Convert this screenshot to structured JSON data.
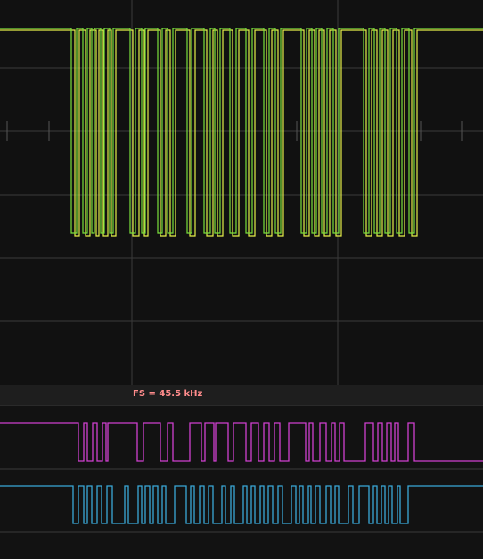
{
  "status": {
    "sample_rate_label": "FS = 45.5 kHz"
  },
  "colors": {
    "background": "#121212",
    "grid": "#3a3a3a",
    "analog_trace_yellow": "#e6f04a",
    "analog_trace_green": "#7ae03c",
    "digital_trace_magenta": "#d040d0",
    "digital_trace_cyan": "#3aa8d8",
    "fs_label": "#ff8c8c"
  },
  "traces": {
    "analog_green_edges": [
      80,
      86,
      93,
      98,
      103,
      106,
      113,
      117,
      123,
      127,
      146,
      152,
      159,
      163,
      177,
      182,
      188,
      194,
      210,
      215,
      229,
      236,
      241,
      247,
      258,
      265,
      276,
      283,
      296,
      302,
      309,
      315,
      338,
      344,
      350,
      355,
      361,
      367,
      374,
      380,
      408,
      414,
      420,
      426,
      432,
      438,
      445,
      451,
      459,
      465
    ],
    "analog_yellow_edges": [
      84,
      89,
      96,
      101,
      108,
      111,
      116,
      121,
      125,
      130,
      149,
      156,
      162,
      166,
      180,
      186,
      191,
      197,
      213,
      219,
      232,
      239,
      244,
      250,
      261,
      268,
      279,
      286,
      299,
      305,
      312,
      318,
      341,
      347,
      353,
      358,
      364,
      370,
      377,
      383,
      411,
      417,
      423,
      429,
      435,
      441,
      448,
      454,
      462,
      468
    ],
    "digital_magenta_edges": [
      88,
      94,
      98,
      104,
      109,
      115,
      119,
      121,
      154,
      161,
      180,
      188,
      194,
      213,
      226,
      230,
      240,
      242,
      256,
      262,
      276,
      282,
      290,
      296,
      302,
      308,
      314,
      324,
      343,
      347,
      351,
      359,
      366,
      372,
      376,
      381,
      386,
      410,
      419,
      424,
      429,
      434,
      439,
      443,
      447,
      458,
      465
    ],
    "digital_cyan_edges": [
      82,
      88,
      94,
      98,
      103,
      109,
      114,
      120,
      126,
      140,
      144,
      155,
      159,
      163,
      168,
      172,
      177,
      182,
      186,
      196,
      209,
      214,
      218,
      224,
      229,
      234,
      239,
      249,
      253,
      259,
      263,
      273,
      277,
      282,
      286,
      292,
      296,
      301,
      306,
      312,
      317,
      327,
      332,
      336,
      340,
      346,
      349,
      354,
      359,
      366,
      371,
      376,
      380,
      391,
      396,
      403,
      414,
      419,
      423,
      428,
      432,
      436,
      440,
      446,
      449,
      458
    ]
  }
}
